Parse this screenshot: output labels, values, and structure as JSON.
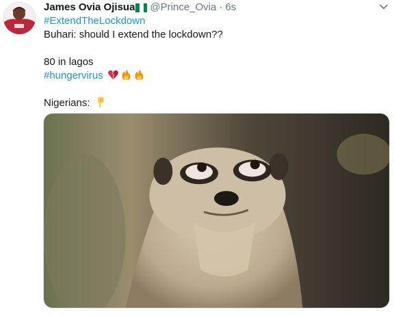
{
  "tweet": {
    "author_name": "James Ovia Ojisua",
    "handle": "@Prince_Ovia",
    "separator": "·",
    "timestamp": "6s",
    "hashtag_main": "#ExtendTheLockdown",
    "line_question": "Buhari: should I extend the lockdown??",
    "line_lagos": "80 in lagos",
    "hashtag_virus": "#hungervirus",
    "line_nigerians": "Nigerians:"
  },
  "icons": {
    "flag": "nigeria-flag-emoji",
    "broken_heart": "broken-heart-emoji",
    "fire": "fire-emoji",
    "pointing": "backhand-index-pointing-down-emoji",
    "menu": "chevron-down-icon"
  },
  "colors": {
    "link": "#1b95e0",
    "secondary_text": "#657786",
    "primary_text": "#14171a"
  }
}
